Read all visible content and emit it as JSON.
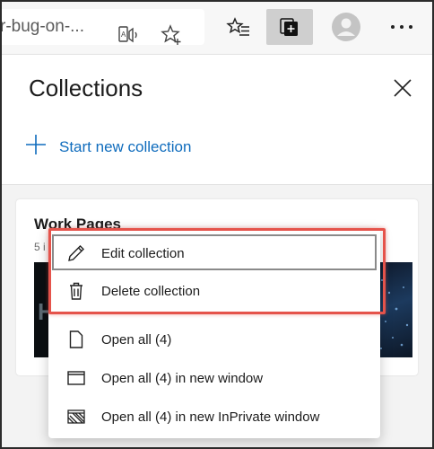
{
  "toolbar": {
    "url_text": "r-bug-on-...",
    "icons": [
      "read-aloud-icon",
      "favorite-star-icon",
      "favorites-icon",
      "collections-icon",
      "profile-icon",
      "more-icon"
    ],
    "more_label": "···"
  },
  "panel": {
    "title": "Collections",
    "start_new_label": "Start new collection"
  },
  "card": {
    "title": "Work Pages",
    "meta": "5 i",
    "thumb_text": "Hu"
  },
  "context_menu": {
    "items": [
      {
        "label": "Edit collection",
        "icon": "pencil-icon"
      },
      {
        "label": "Delete collection",
        "icon": "trash-icon"
      },
      {
        "label": "Open all (4)",
        "icon": "page-icon"
      },
      {
        "label": "Open all (4) in new window",
        "icon": "window-icon"
      },
      {
        "label": "Open all (4) in new InPrivate window",
        "icon": "inprivate-window-icon"
      }
    ]
  },
  "colors": {
    "accent": "#0f6cbd",
    "highlight": "#e5534b"
  }
}
